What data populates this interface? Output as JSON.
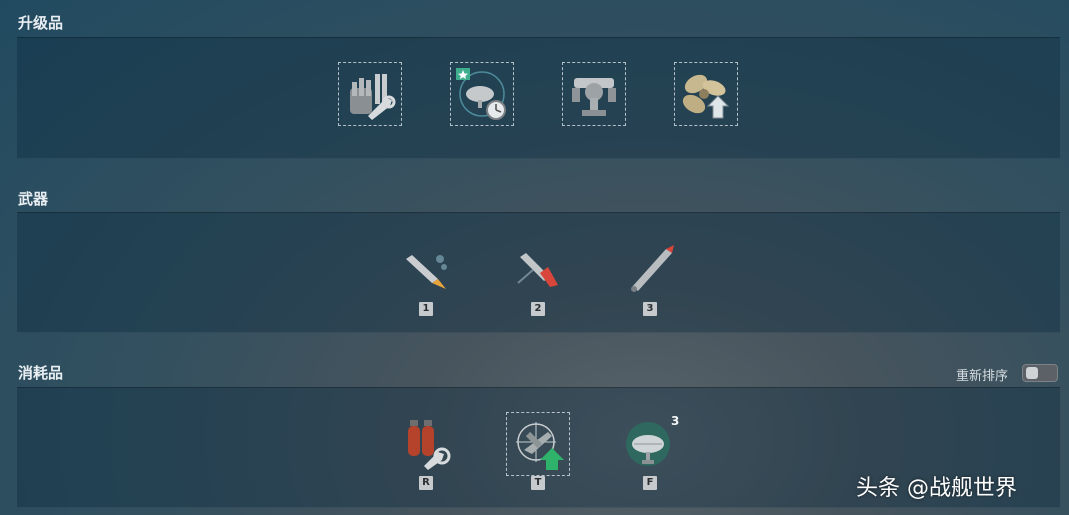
{
  "sections": {
    "upgrades": {
      "title": "升级品"
    },
    "weapons": {
      "title": "武器",
      "hotkeys": [
        "1",
        "2",
        "3"
      ]
    },
    "consumables": {
      "title": "消耗品",
      "reorder_label": "重新排序",
      "hotkeys": [
        "R",
        "T",
        "F"
      ],
      "hydro_count": "3"
    }
  },
  "watermark": "头条 @战舰世界",
  "icons": {
    "upgrades": [
      "main-battery-mod-icon",
      "hydroacoustic-timer-icon",
      "steering-gear-icon",
      "propulsion-upgrade-icon"
    ],
    "weapons": [
      "he-shell-icon",
      "ap-shell-icon",
      "torpedo-icon"
    ],
    "consumables": [
      "damage-control-icon",
      "spotter-aircraft-icon",
      "hydroacoustic-search-icon"
    ]
  }
}
